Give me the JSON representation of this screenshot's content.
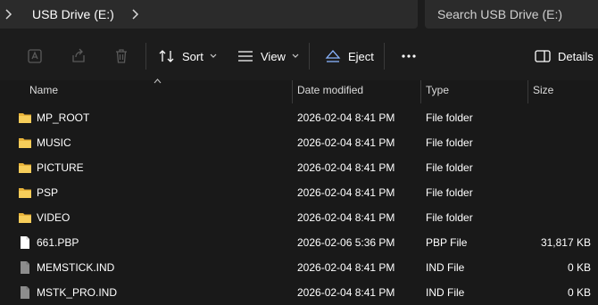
{
  "address": {
    "crumb": "USB Drive (E:)"
  },
  "search": {
    "placeholder": "Search USB Drive (E:)"
  },
  "toolbar": {
    "sort_label": "Sort",
    "view_label": "View",
    "eject_label": "Eject",
    "details_label": "Details"
  },
  "columns": {
    "name": "Name",
    "date": "Date modified",
    "type": "Type",
    "size": "Size"
  },
  "files": [
    {
      "name": "MP_ROOT",
      "date": "2026-02-04 8:41 PM",
      "type": "File folder",
      "size": "",
      "icon": "folder-icon"
    },
    {
      "name": "MUSIC",
      "date": "2026-02-04 8:41 PM",
      "type": "File folder",
      "size": "",
      "icon": "folder-icon"
    },
    {
      "name": "PICTURE",
      "date": "2026-02-04 8:41 PM",
      "type": "File folder",
      "size": "",
      "icon": "folder-icon"
    },
    {
      "name": "PSP",
      "date": "2026-02-04 8:41 PM",
      "type": "File folder",
      "size": "",
      "icon": "folder-icon"
    },
    {
      "name": "VIDEO",
      "date": "2026-02-04 8:41 PM",
      "type": "File folder",
      "size": "",
      "icon": "folder-icon"
    },
    {
      "name": "661.PBP",
      "date": "2026-02-06 5:36 PM",
      "type": "PBP File",
      "size": "31,817 KB",
      "icon": "file-icon"
    },
    {
      "name": "MEMSTICK.IND",
      "date": "2026-02-04 8:41 PM",
      "type": "IND File",
      "size": "0 KB",
      "icon": "grey-file-icon"
    },
    {
      "name": "MSTK_PRO.IND",
      "date": "2026-02-04 8:41 PM",
      "type": "IND File",
      "size": "0 KB",
      "icon": "grey-file-icon"
    }
  ],
  "colors": {
    "folder": "#f2c14e",
    "eject_accent": "#8ab4ff"
  }
}
